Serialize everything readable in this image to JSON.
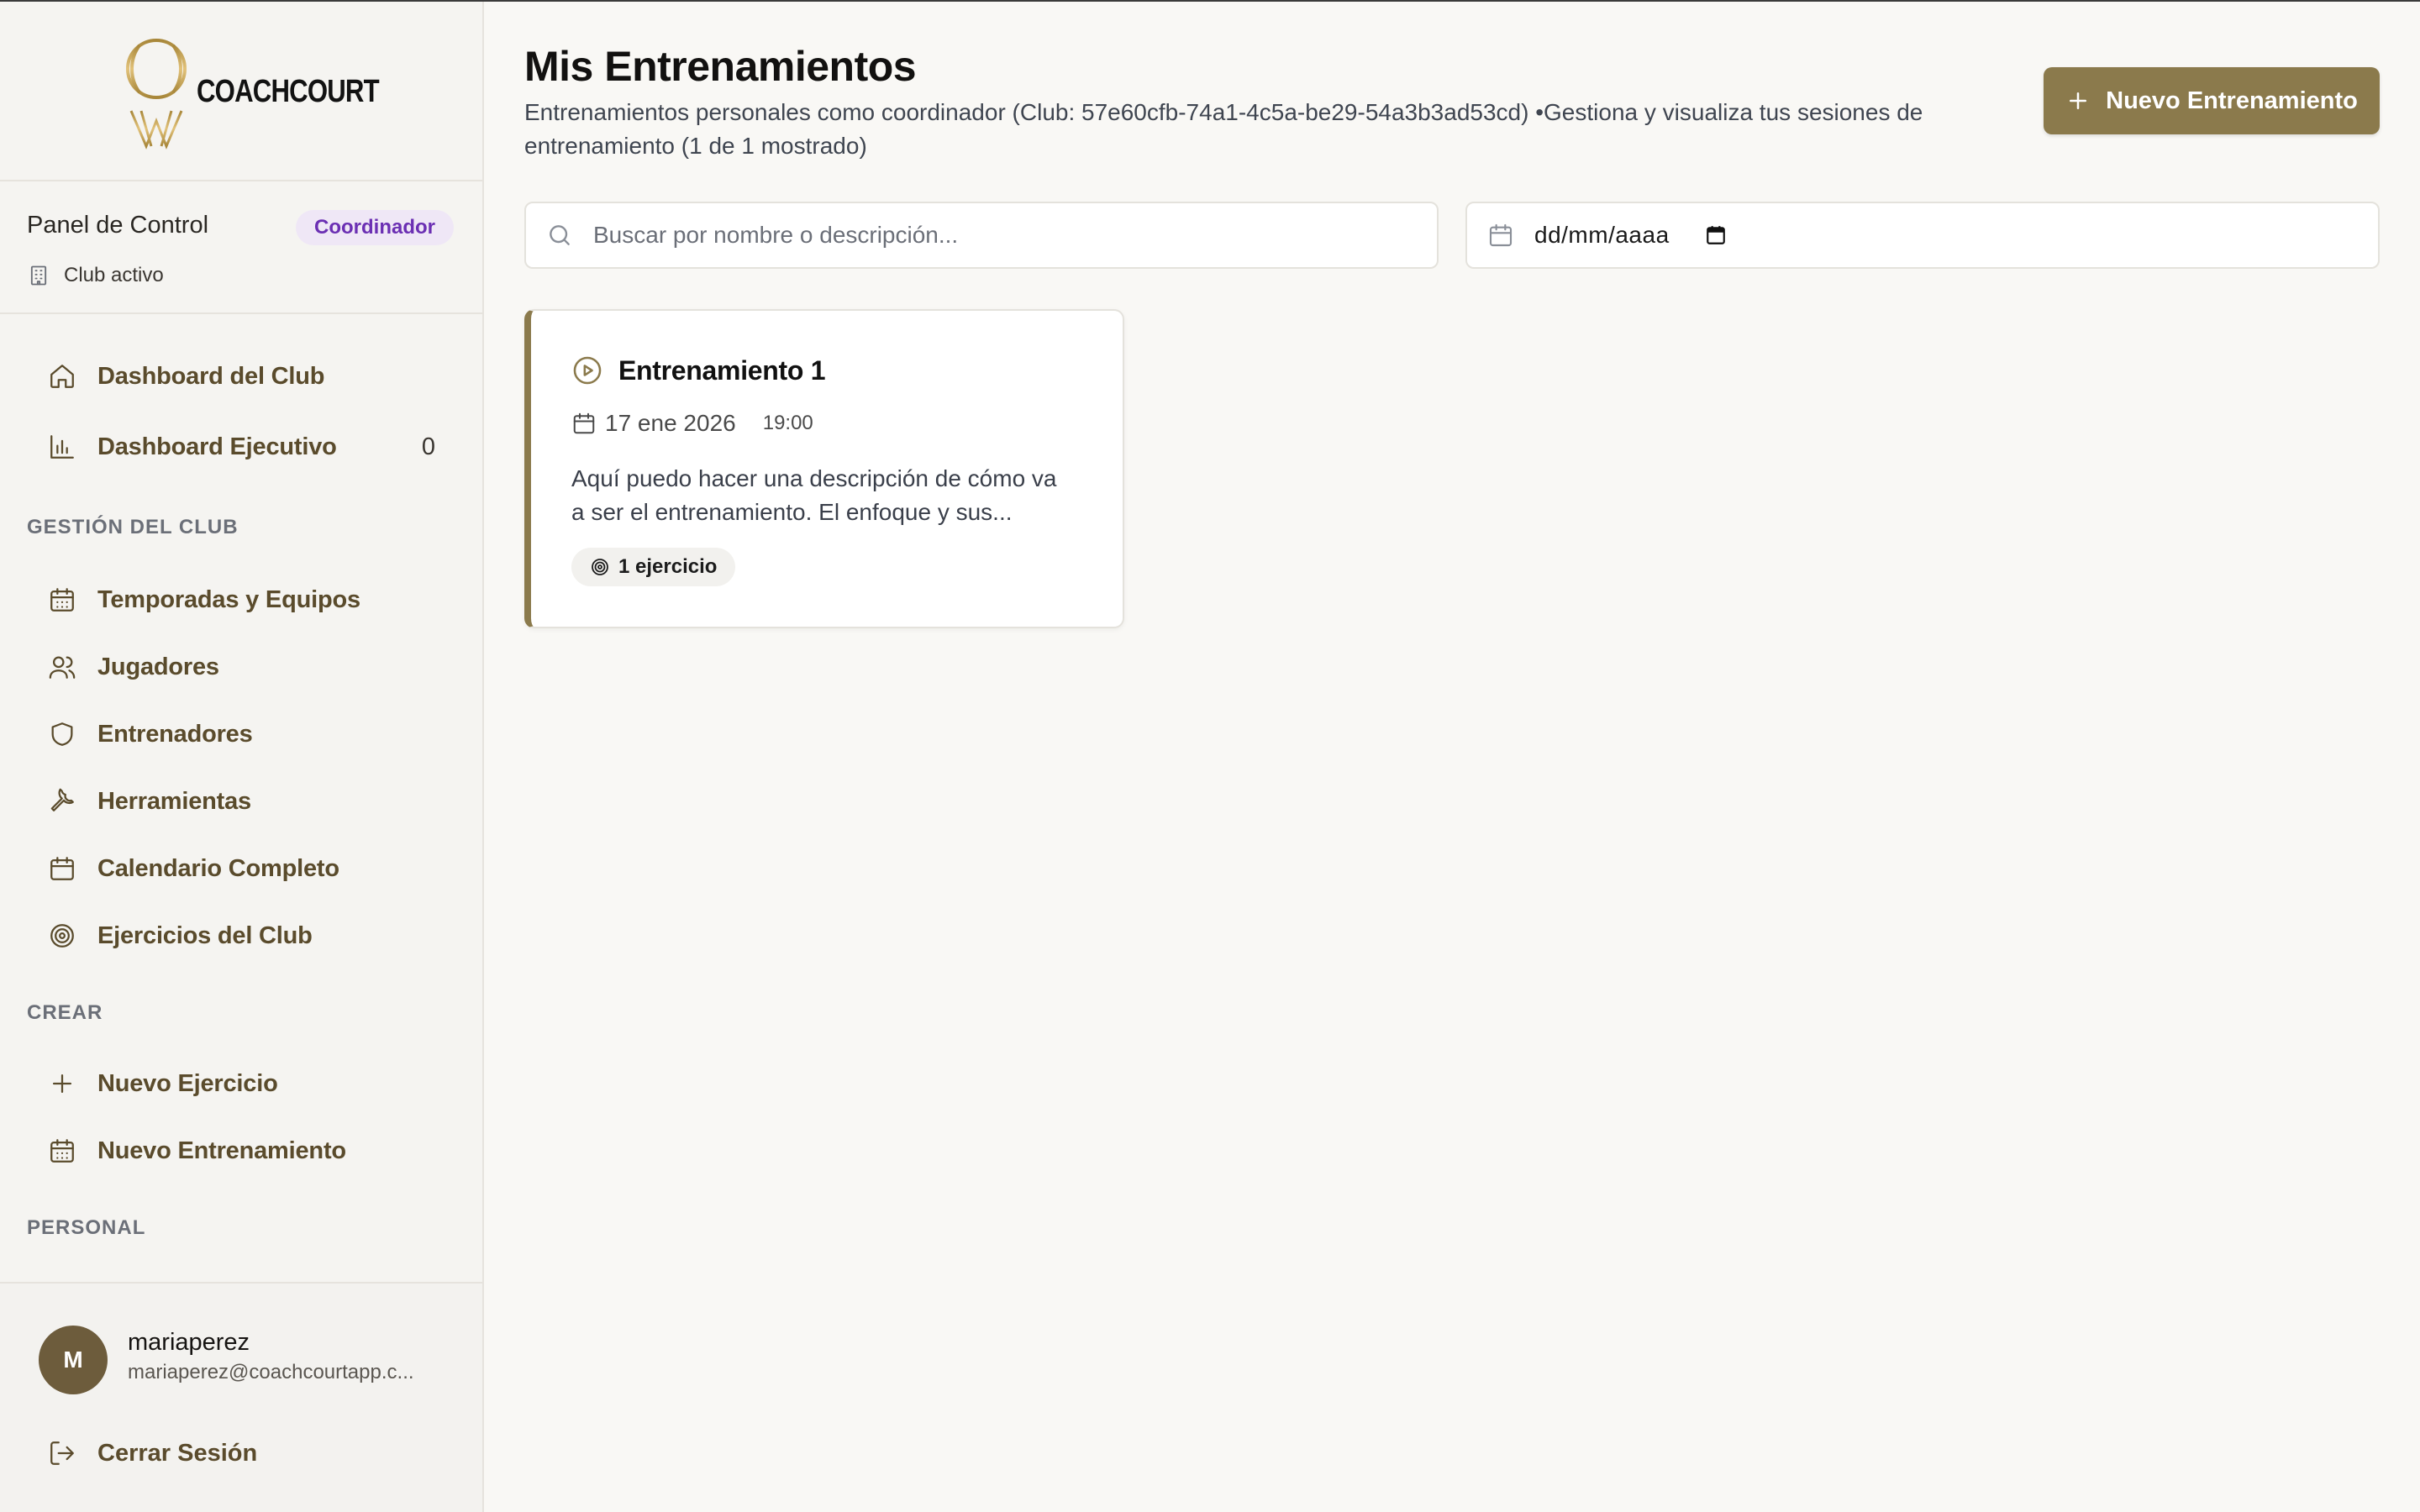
{
  "brand": {
    "name": "COACHCOURT",
    "accent": "#8b7a4c",
    "logo_gold": "#c9a24a"
  },
  "panel": {
    "title": "Panel de Control",
    "role": "Coordinador",
    "club_status": "Club activo"
  },
  "nav": {
    "main": [
      {
        "label": "Dashboard del Club",
        "icon": "home-icon"
      },
      {
        "label": "Dashboard Ejecutivo",
        "icon": "bar-chart-icon",
        "count": "0"
      }
    ],
    "club_section_label": "GESTIÓN DEL CLUB",
    "club": [
      {
        "label": "Temporadas y Equipos",
        "icon": "calendar-grid-icon"
      },
      {
        "label": "Jugadores",
        "icon": "users-icon"
      },
      {
        "label": "Entrenadores",
        "icon": "shield-icon"
      },
      {
        "label": "Herramientas",
        "icon": "wrench-icon"
      },
      {
        "label": "Calendario Completo",
        "icon": "calendar-icon"
      },
      {
        "label": "Ejercicios del Club",
        "icon": "target-icon"
      }
    ],
    "create_section_label": "CREAR",
    "create": [
      {
        "label": "Nuevo Ejercicio",
        "icon": "plus-icon"
      },
      {
        "label": "Nuevo Entrenamiento",
        "icon": "calendar-grid-icon"
      }
    ],
    "personal_section_label": "PERSONAL"
  },
  "user": {
    "initial": "M",
    "name": "mariaperez",
    "email": "mariaperez@coachcourtapp.c...",
    "logout_label": "Cerrar Sesión"
  },
  "page": {
    "title": "Mis Entrenamientos",
    "subtitle": "Entrenamientos personales como coordinador (Club: 57e60cfb-74a1-4c5a-be29-54a3b3ad53cd) •Gestiona y visualiza tus sesiones de entrenamiento (1 de 1 mostrado)",
    "new_button_label": "Nuevo Entrenamiento"
  },
  "filters": {
    "search_placeholder": "Buscar por nombre o descripción...",
    "search_value": "",
    "date_placeholder": "dd/mm/aaaa"
  },
  "trainings": [
    {
      "title": "Entrenamiento 1",
      "date": "17 ene 2026",
      "time": "19:00",
      "description": "Aquí puedo hacer una descripción de cómo va a ser el entrenamiento. El enfoque y sus...",
      "exercises": "1 ejercicio"
    }
  ]
}
